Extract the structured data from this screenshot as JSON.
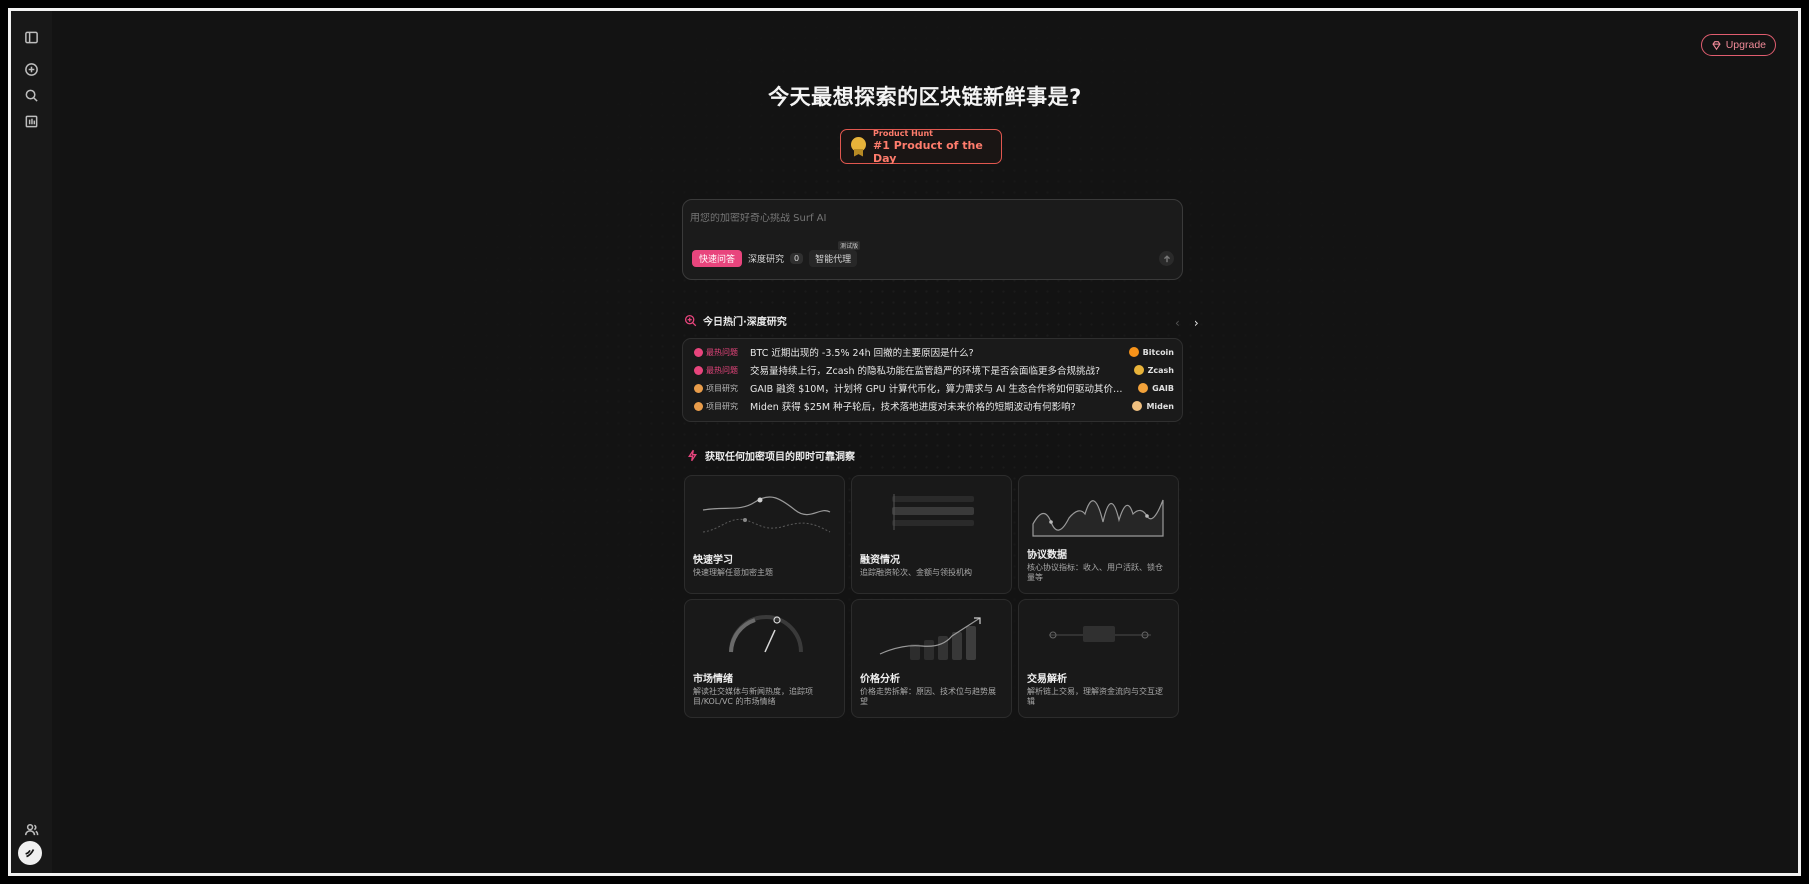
{
  "app": {
    "upgrade_label": "Upgrade",
    "headline": "今天最想探索的区块链新鲜事是?"
  },
  "badge": {
    "small": "Product Hunt",
    "big": "#1 Product of the Day"
  },
  "chat": {
    "placeholder": "用您的加密好奇心挑战 Surf AI",
    "modes": {
      "quick": "快速问答",
      "deep": "深度研究",
      "deep_count": "0",
      "agent": "智能代理",
      "agent_badge": "测试版"
    }
  },
  "trending": {
    "title": "今日热门·深度研究",
    "prev": "‹",
    "next": "›",
    "items": [
      {
        "tag": "最热问题",
        "tag_color": "#e8457d",
        "question": "BTC 近期出现的 -3.5% 24h 回撤的主要原因是什么?",
        "coin": "Bitcoin",
        "coin_color": "#f7931a"
      },
      {
        "tag": "最热问题",
        "tag_color": "#e8457d",
        "question": "交易量持续上行，Zcash 的隐私功能在监管趋严的环境下是否会面临更多合规挑战?",
        "coin": "Zcash",
        "coin_color": "#e8b33a"
      },
      {
        "tag": "项目研究",
        "tag_color": "#e89c4a",
        "question": "GAIB 融资 $10M，计划将 GPU 计算代币化，算力需求与 AI 生态合作将如何驱动其价格...",
        "coin": "GAIB",
        "coin_color": "#f2a23a"
      },
      {
        "tag": "项目研究",
        "tag_color": "#e89c4a",
        "question": "Miden 获得 $25M 种子轮后，技术落地进度对未来价格的短期波动有何影响?",
        "coin": "Miden",
        "coin_color": "#f0c080"
      }
    ]
  },
  "insights": {
    "title": "获取任何加密项目的即时可靠洞察",
    "cards": [
      {
        "title": "快速学习",
        "desc": "快速理解任意加密主题"
      },
      {
        "title": "融资情况",
        "desc": "追踪融资轮次、金额与领投机构"
      },
      {
        "title": "协议数据",
        "desc": "核心协议指标：收入、用户活跃、锁仓量等"
      },
      {
        "title": "市场情绪",
        "desc": "解读社交媒体与新闻热度，追踪项目/KOL/VC 的市场情绪"
      },
      {
        "title": "价格分析",
        "desc": "价格走势拆解：原因、技术位与趋势展望"
      },
      {
        "title": "交易解析",
        "desc": "解析链上交易，理解资金流向与交互逻辑"
      }
    ]
  },
  "colors": {
    "accent": "#e8457d",
    "upgrade": "#e05d6f",
    "badge": "#ff7c6c",
    "background": "#131313"
  },
  "icons": {
    "sidebar": [
      "sidebar-toggle-icon",
      "new-chat-icon",
      "search-icon",
      "library-icon",
      "user-icon",
      "surf-logo-icon"
    ]
  }
}
